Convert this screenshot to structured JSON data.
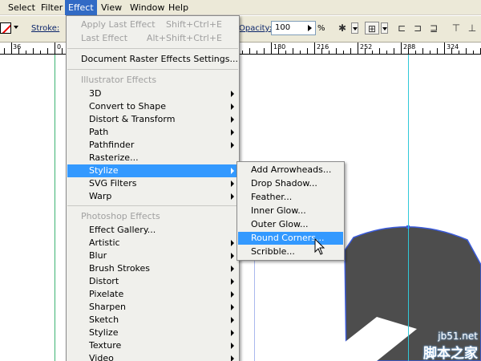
{
  "menubar": {
    "items": [
      "Select",
      "Filter",
      "Effect",
      "View",
      "Window",
      "Help"
    ],
    "active": "Effect"
  },
  "controlbar": {
    "stroke_label": "Stroke:",
    "opacity_label": "Opacity:",
    "opacity_value": "100",
    "percent": "%"
  },
  "ruler": {
    "labels": [
      "36",
      "0",
      "180",
      "216",
      "252",
      "288",
      "324"
    ]
  },
  "effect_menu": {
    "apply_last": {
      "label": "Apply Last Effect",
      "shortcut": "Shift+Ctrl+E"
    },
    "last_effect": {
      "label": "Last Effect",
      "shortcut": "Alt+Shift+Ctrl+E"
    },
    "doc_raster": "Document Raster Effects Settings...",
    "illustrator_header": "Illustrator Effects",
    "illustrator_items": [
      "3D",
      "Convert to Shape",
      "Distort & Transform",
      "Path",
      "Pathfinder",
      "Rasterize...",
      "Stylize",
      "SVG Filters",
      "Warp"
    ],
    "photoshop_header": "Photoshop Effects",
    "photoshop_items": [
      "Effect Gallery...",
      "Artistic",
      "Blur",
      "Brush Strokes",
      "Distort",
      "Pixelate",
      "Sharpen",
      "Sketch",
      "Stylize",
      "Texture",
      "Video"
    ],
    "highlighted": "Stylize"
  },
  "stylize_menu": {
    "items": [
      "Add Arrowheads...",
      "Drop Shadow...",
      "Feather...",
      "Inner Glow...",
      "Outer Glow...",
      "Round Corners...",
      "Scribble..."
    ],
    "highlighted": "Round Corners..."
  },
  "watermark": {
    "url": "jb51.net",
    "cn": "脚本之家"
  },
  "colors": {
    "menu_highlight": "#3399ff",
    "hat_fill": "#4d4d4d",
    "path_stroke": "#3b5bdb"
  }
}
